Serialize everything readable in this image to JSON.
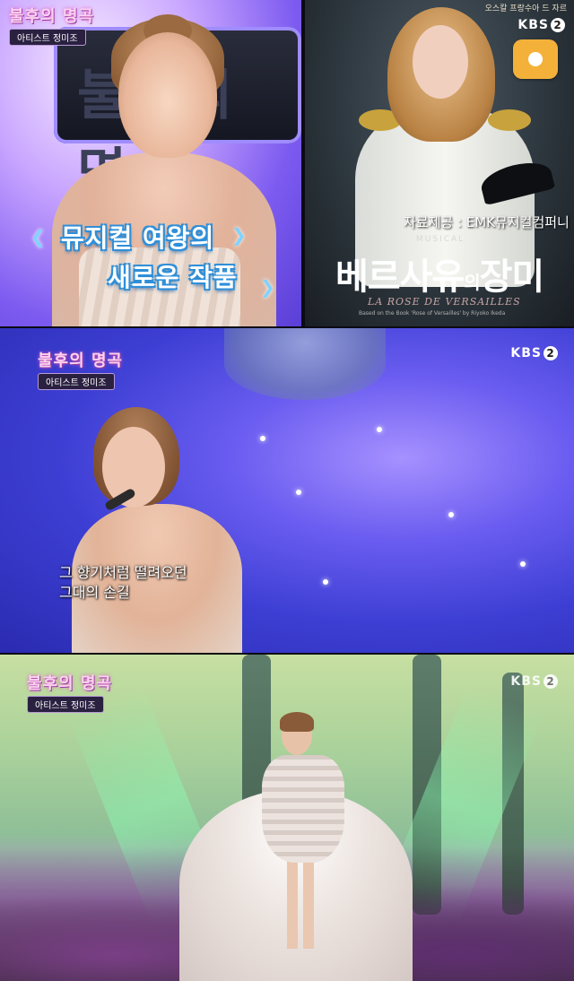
{
  "show_logo": {
    "title": "불후의 명곡",
    "artist_tag": "아티스트 정미조"
  },
  "panel1": {
    "screen_text": "불후의 명",
    "caption_line1": "뮤지컬 여왕의",
    "caption_line2": "새로운 작품",
    "poster": {
      "top_text": "오스칼 프랑수아 드 자르",
      "broadcaster": "KBS",
      "broadcaster_num": "2",
      "credit": "자료제공 : EMK뮤지컬컴퍼니",
      "musical_label": "MUSICAL",
      "title_part1": "베르사유",
      "title_small": "의",
      "title_part2": "장미",
      "subtitle": "LA ROSE DE VERSAILLES",
      "fine_print": "Based on the Book 'Rose of Versailles' by Riyoko Ikeda"
    },
    "icon_colors": {
      "orange_button": "#f4b13a"
    }
  },
  "panel2": {
    "broadcaster": "KBS",
    "broadcaster_num": "2",
    "lyrics": [
      "그 향기처럼 떨려오던",
      "그대의 손길"
    ]
  },
  "panel3": {
    "broadcaster": "KBS",
    "broadcaster_num": "2"
  }
}
